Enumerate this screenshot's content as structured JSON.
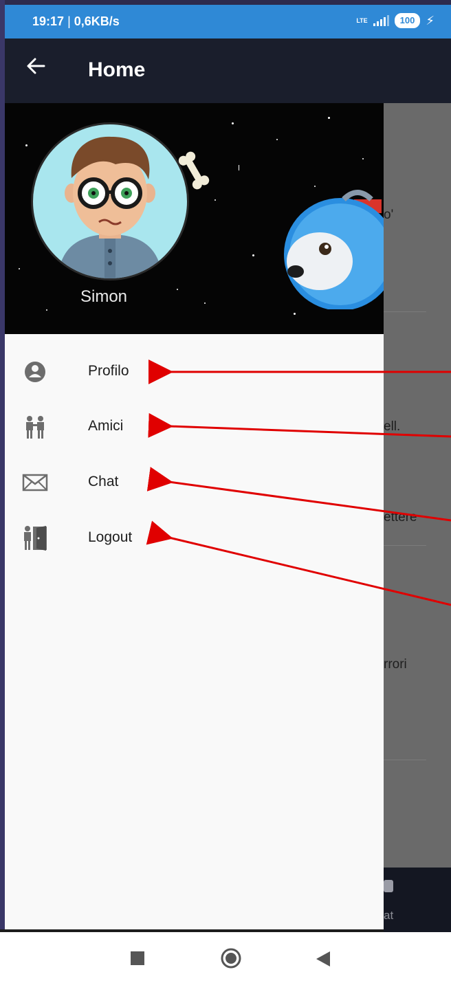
{
  "status_bar": {
    "time": "19:17",
    "separator": "|",
    "network_speed": "0,6KB/s",
    "network_type": "LTE",
    "battery": "100"
  },
  "app_bar": {
    "back_icon": "back-arrow-icon",
    "title": "Home"
  },
  "drawer": {
    "user_name": "Simon",
    "menu": [
      {
        "label": "Profilo",
        "icon": "profile-icon"
      },
      {
        "label": "Amici",
        "icon": "friends-icon"
      },
      {
        "label": "Chat",
        "icon": "mail-icon"
      },
      {
        "label": "Logout",
        "icon": "logout-door-icon"
      }
    ]
  },
  "background_content": {
    "fragments": [
      "o'",
      "ell.",
      "ettere",
      "rrori"
    ],
    "bottom_nav_label": "at"
  },
  "colors": {
    "status_bar": "#2f89d6",
    "app_bar": "#1a1e2c",
    "drawer_bg": "#f9f9f9",
    "arrow": "#e00000"
  }
}
